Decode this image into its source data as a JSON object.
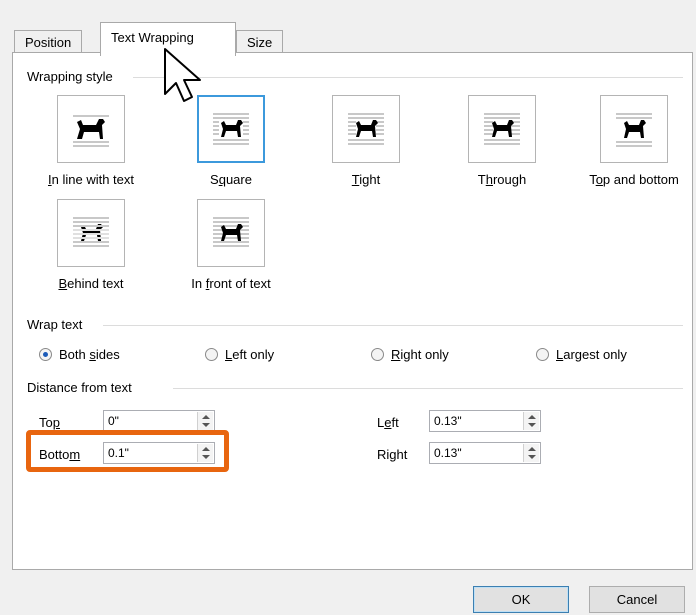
{
  "tabs": [
    {
      "label": "Position"
    },
    {
      "label": "Text Wrapping"
    },
    {
      "label": "Size"
    }
  ],
  "wrapping_style": {
    "title": "Wrapping style",
    "options": [
      {
        "pre": "",
        "key": "I",
        "post": "n line with text",
        "selected": false,
        "icon": "inline-dog-icon"
      },
      {
        "pre": "S",
        "key": "q",
        "post": "uare",
        "selected": true,
        "icon": "square-wrap-icon"
      },
      {
        "pre": "",
        "key": "T",
        "post": "ight",
        "selected": false,
        "icon": "tight-wrap-icon"
      },
      {
        "pre": "T",
        "key": "h",
        "post": "rough",
        "selected": false,
        "icon": "through-wrap-icon"
      },
      {
        "pre": "T",
        "key": "o",
        "post": "p and bottom",
        "selected": false,
        "icon": "top-bottom-wrap-icon"
      },
      {
        "pre": "",
        "key": "B",
        "post": "ehind text",
        "selected": false,
        "icon": "behind-text-icon"
      },
      {
        "pre": "In ",
        "key": "f",
        "post": "ront of text",
        "selected": false,
        "icon": "in-front-of-text-icon"
      }
    ]
  },
  "wrap_text": {
    "title": "Wrap text",
    "options": [
      {
        "pre": "Both ",
        "key": "s",
        "post": "ides",
        "checked": true
      },
      {
        "pre": "",
        "key": "L",
        "post": "eft only",
        "checked": false
      },
      {
        "pre": "",
        "key": "R",
        "post": "ight only",
        "checked": false
      },
      {
        "pre": "",
        "key": "L",
        "post": "argest only",
        "checked": false
      }
    ]
  },
  "distance": {
    "title": "Distance from text",
    "top": {
      "label_pre": "To",
      "label_key": "p",
      "label_post": "",
      "value": "0\""
    },
    "bottom": {
      "label_pre": "Botto",
      "label_key": "m",
      "label_post": "",
      "value": "0.1\""
    },
    "left": {
      "label_pre": "L",
      "label_key": "e",
      "label_post": "ft",
      "value": "0.13\""
    },
    "right": {
      "label_pre": "Ri",
      "label_key": "g",
      "label_post": "ht",
      "value": "0.13\""
    }
  },
  "buttons": {
    "ok": "OK",
    "cancel": "Cancel"
  },
  "colors": {
    "highlight": "#e8650f",
    "selection": "#3c99dc",
    "radio_fill": "#1c5bb8"
  }
}
